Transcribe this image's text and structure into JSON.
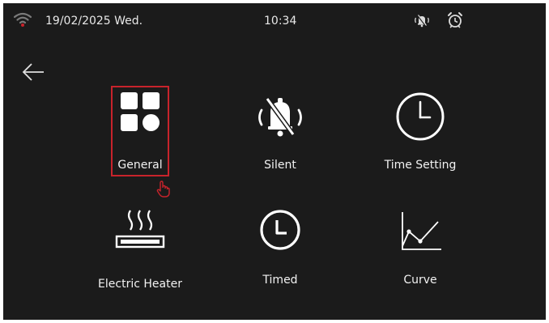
{
  "status": {
    "date": "19/02/2025 Wed.",
    "time": "10:34",
    "icons": [
      "wifi-icon",
      "mute-icon",
      "alarm-clock-icon"
    ],
    "wifi_color": "#c8232b"
  },
  "navigation": {
    "back_icon": "arrow-left-icon"
  },
  "menu": {
    "selected_index": 0,
    "selection_color": "#c8232b",
    "items": [
      {
        "label": "General",
        "icon": "grid-icon"
      },
      {
        "label": "Silent",
        "icon": "bell-mute-icon"
      },
      {
        "label": "Time Setting",
        "icon": "clock-icon"
      },
      {
        "label": "Electric Heater",
        "icon": "heater-icon"
      },
      {
        "label": "Timed",
        "icon": "timer-icon"
      },
      {
        "label": "Curve",
        "icon": "curve-chart-icon"
      }
    ]
  }
}
